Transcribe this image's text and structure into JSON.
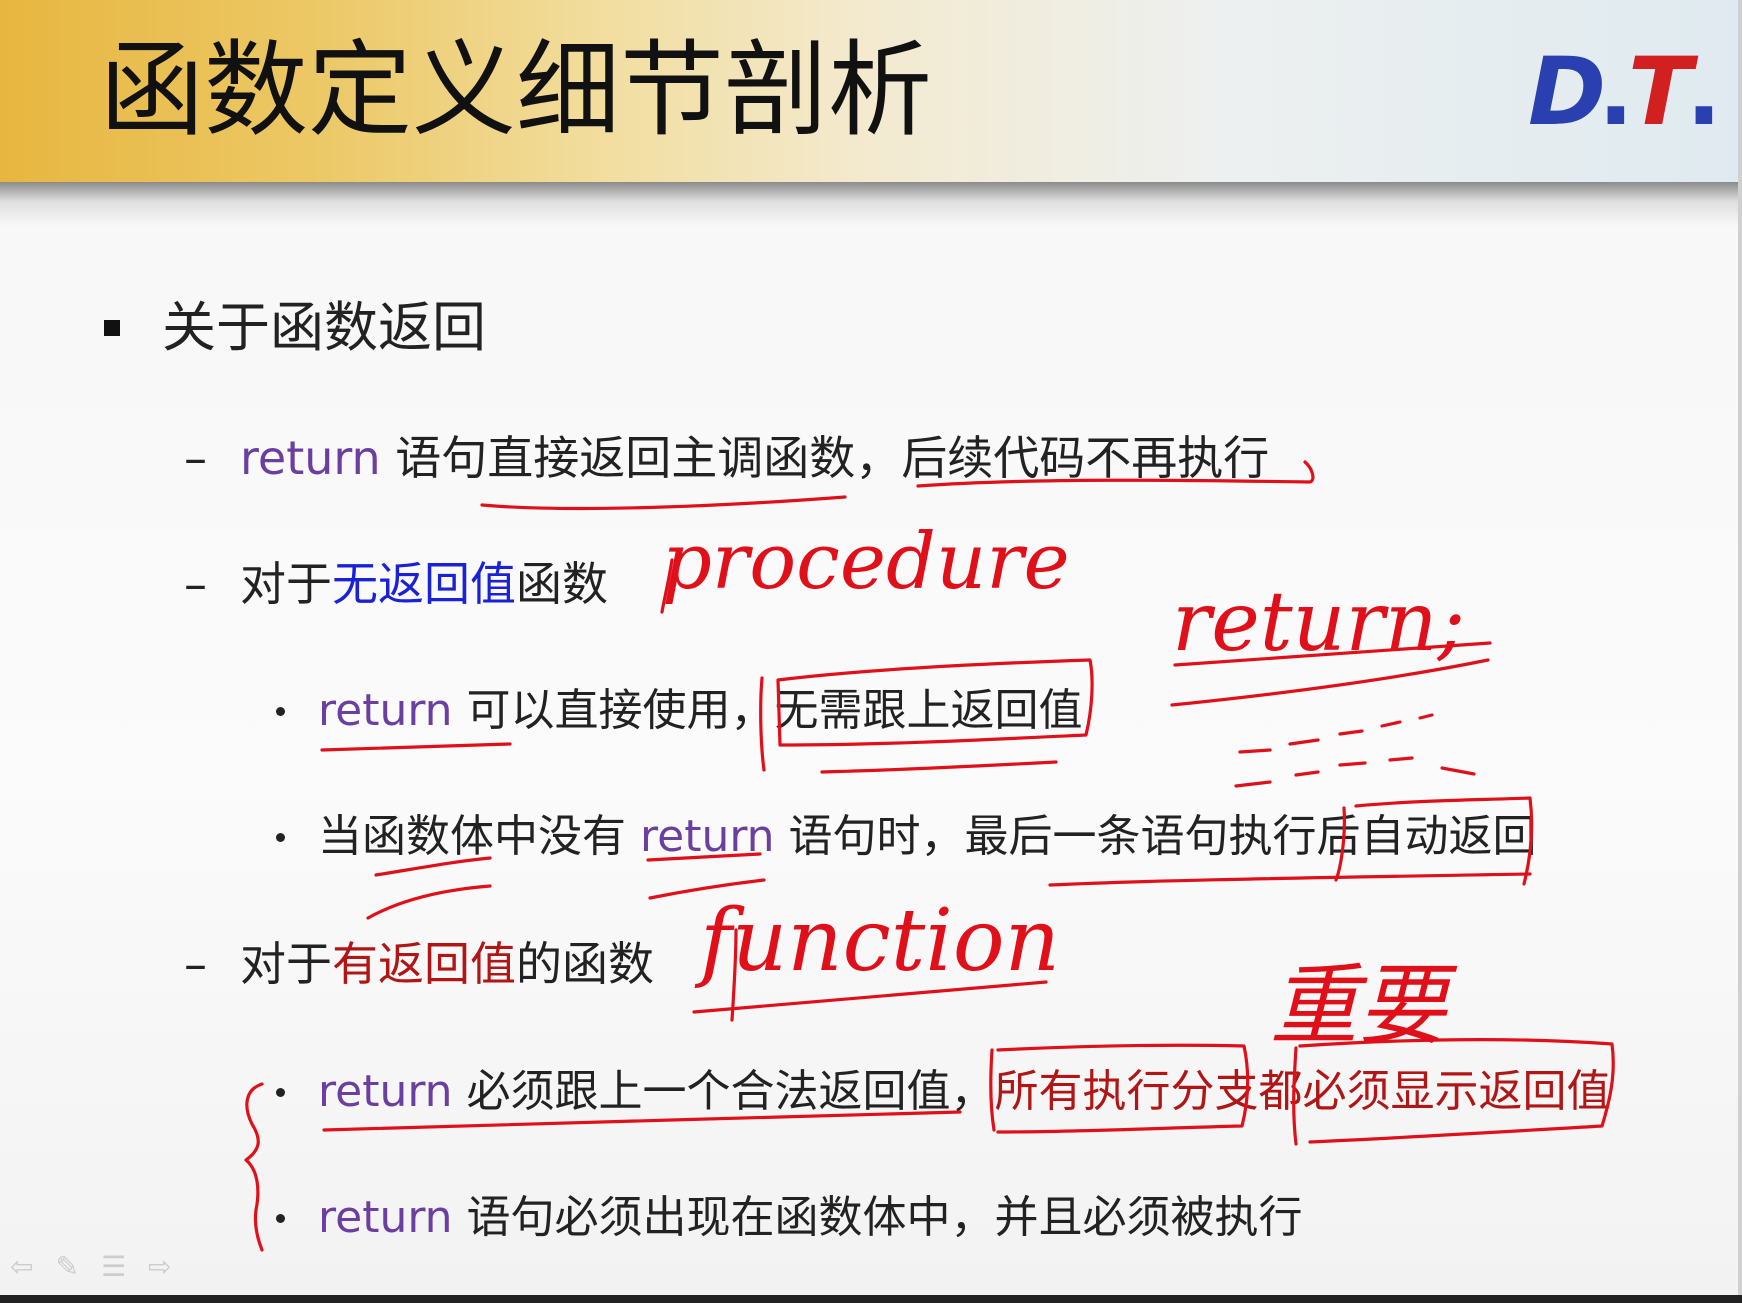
{
  "slide": {
    "title": "函数定义细节剖析",
    "logo": {
      "text_d": "D",
      "text_dot1": ".",
      "text_t": "T",
      "text_dot2": ".",
      "color_blue": "#2a3fb0",
      "color_red": "#d21f1f"
    },
    "bullets": {
      "main": {
        "text": "关于函数返回"
      },
      "b1": {
        "keyword": "return",
        "text": " 语句直接返回主调函数，后续代码不再执行"
      },
      "b2": {
        "pre": "对于",
        "highlight": "无返回值",
        "post": "函数"
      },
      "b2_1": {
        "keyword": "return",
        "text": " 可以直接使用，无需跟上返回值"
      },
      "b2_2": {
        "pre": "当函数体中没有 ",
        "keyword": "return",
        "post": " 语句时，最后一条语句执行后自动返回"
      },
      "b3": {
        "pre": "对于",
        "highlight": "有返回值",
        "post": "的函数"
      },
      "b3_1": {
        "keyword": "return",
        "text": " 必须跟上一个合法返回值，",
        "highlight": "所有执行分支都必须显示返回值"
      },
      "b3_2": {
        "keyword": "return",
        "text": " 语句必须出现在函数体中，并且必须被执行"
      }
    },
    "annotations": {
      "procedure": "procedure",
      "return_stmt": "return;",
      "function": "function",
      "important": "重要"
    },
    "colors": {
      "keyword": "#6b3fa0",
      "no_return_value": "#1a22d8",
      "has_return_value": "#b01616",
      "ink": "#e0101a"
    },
    "nav_icons": [
      "back-arrow-icon",
      "pen-icon",
      "menu-icon",
      "forward-arrow-icon"
    ]
  }
}
